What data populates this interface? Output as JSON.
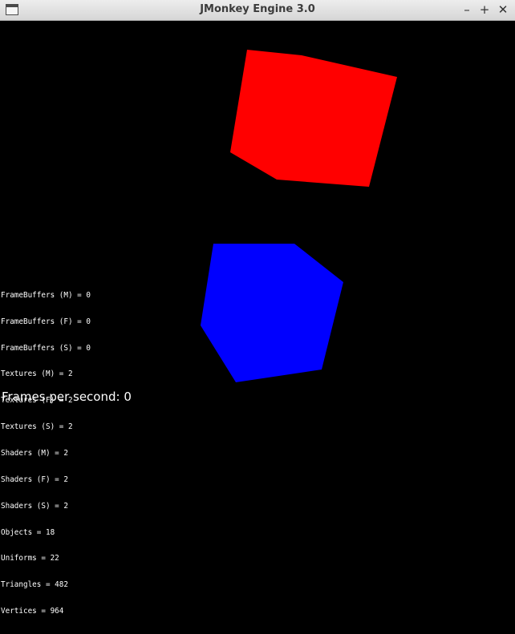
{
  "window": {
    "title": "JMonkey Engine 3.0",
    "icon": "window-icon",
    "controls": {
      "minimize": "–",
      "maximize": "+",
      "close": "✕"
    }
  },
  "scene": {
    "background_color": "#000000",
    "cubes": [
      {
        "name": "red-cube",
        "color": "#ff0000"
      },
      {
        "name": "blue-cube",
        "color": "#0000ff"
      }
    ]
  },
  "stats": {
    "lines": [
      "FrameBuffers (M) = 0",
      "FrameBuffers (F) = 0",
      "FrameBuffers (S) = 0",
      "Textures (M) = 2",
      "Textures (F) = 2",
      "Textures (S) = 2",
      "Shaders (M) = 2",
      "Shaders (F) = 2",
      "Shaders (S) = 2",
      "Objects = 18",
      "Uniforms = 22",
      "Triangles = 482",
      "Vertices = 964"
    ],
    "fps_label": "Frames per second: 0"
  }
}
